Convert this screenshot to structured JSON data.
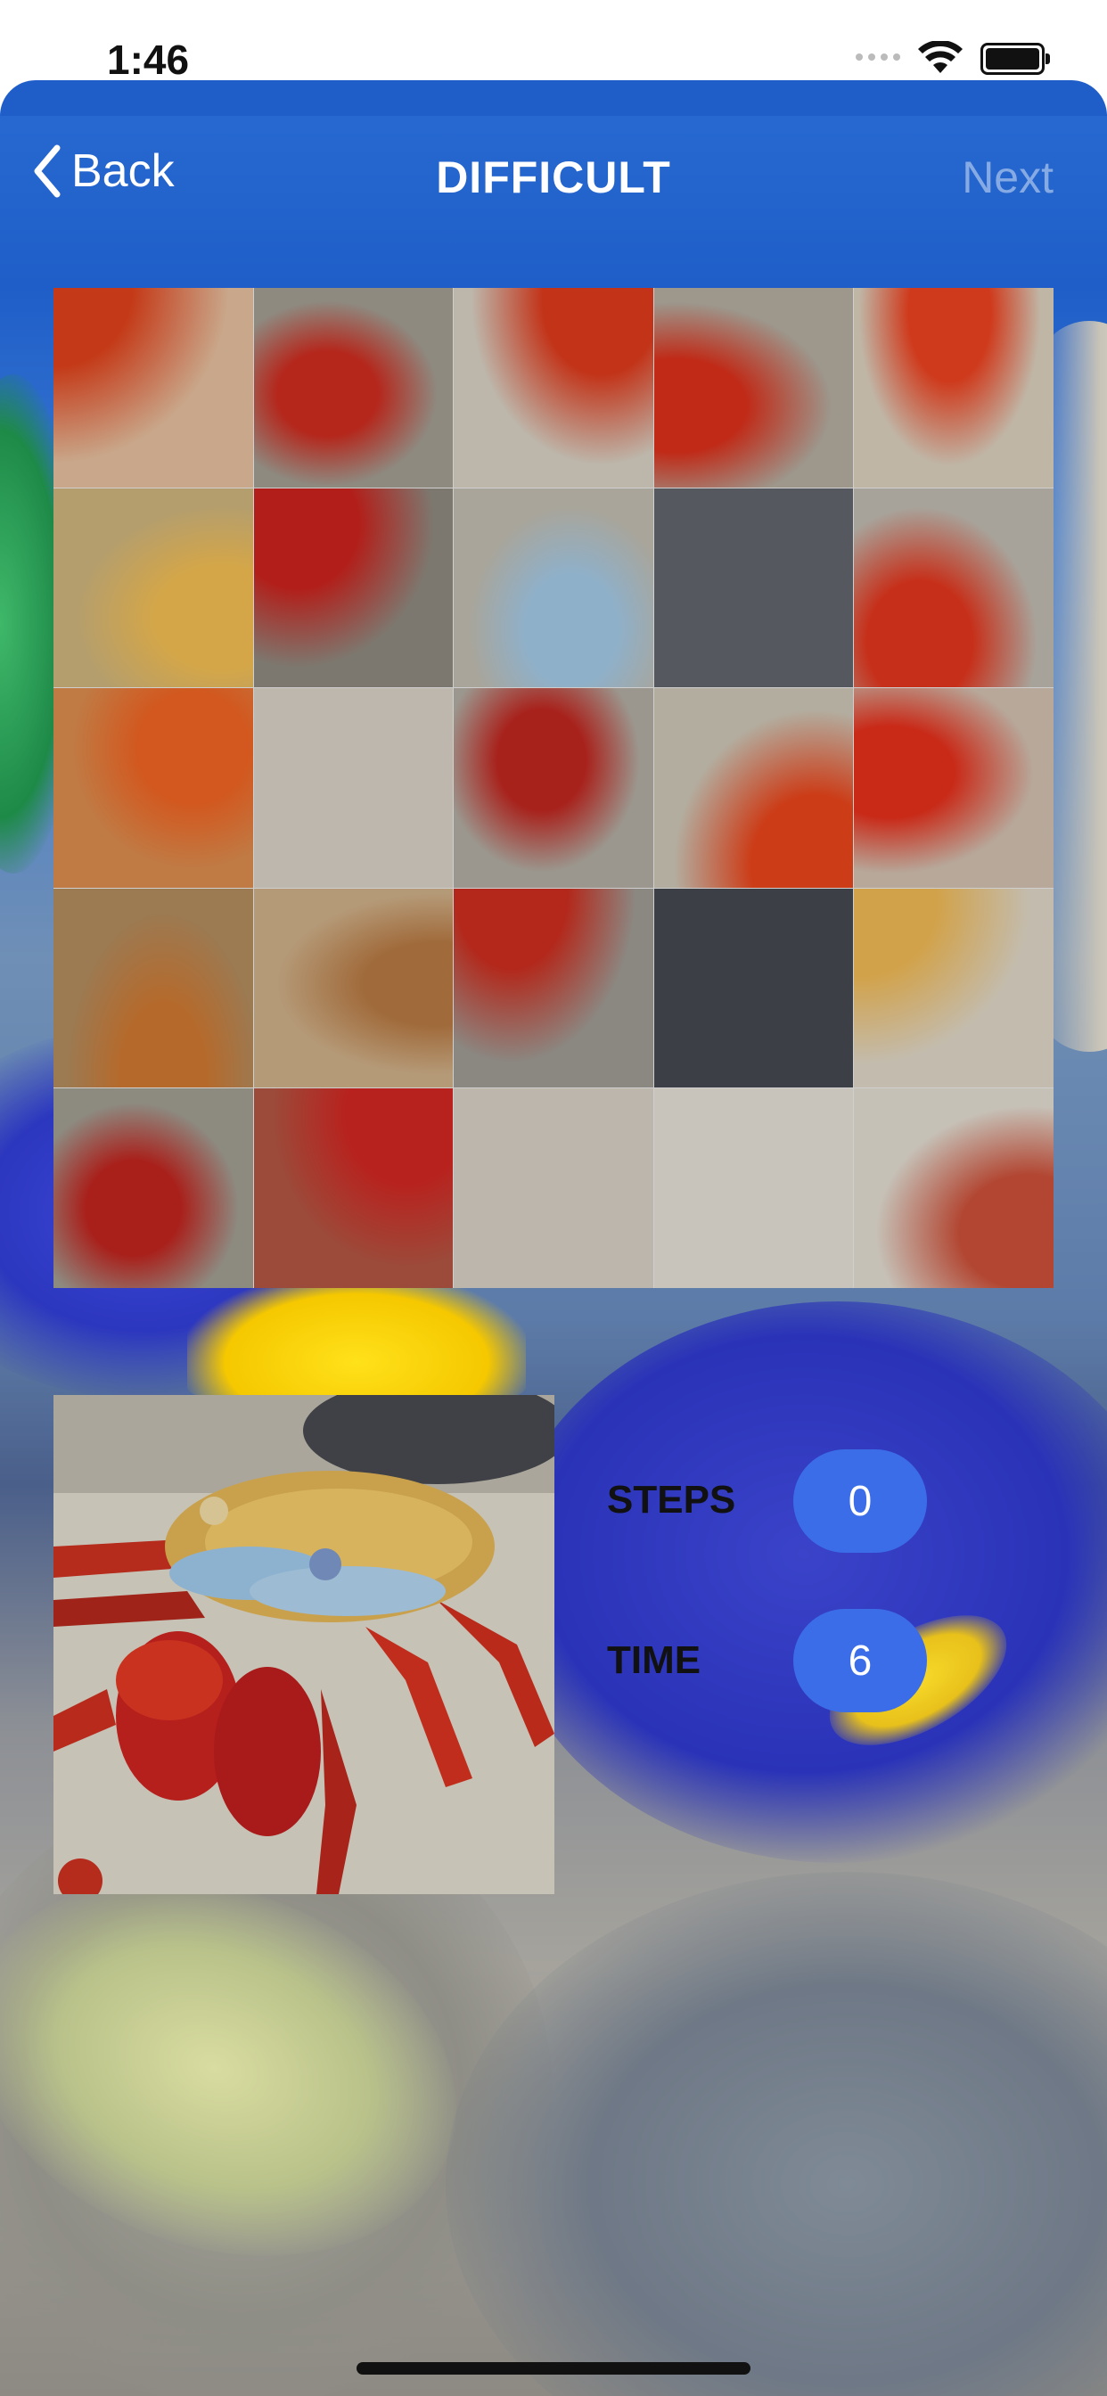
{
  "status_bar": {
    "time": "1:46"
  },
  "nav": {
    "back_label": "Back",
    "title": "DIFFICULT",
    "next_label": "Next"
  },
  "stats": {
    "steps_label": "STEPS",
    "steps_value": "0",
    "time_label": "TIME",
    "time_value": "6"
  },
  "board": {
    "size": 5,
    "tiles": [
      {
        "bg": "#c9a78a",
        "fg": "#c43a18"
      },
      {
        "bg": "#8e8a80",
        "fg": "#b5261b"
      },
      {
        "bg": "#bdb6aa",
        "fg": "#c23318"
      },
      {
        "bg": "#9d978c",
        "fg": "#c02a17"
      },
      {
        "bg": "#c0b6a6",
        "fg": "#cf3a1c"
      },
      {
        "bg": "#b49e6e",
        "fg": "#d4a648"
      },
      {
        "bg": "#7d786f",
        "fg": "#b21f1a"
      },
      {
        "bg": "#a9a59a",
        "fg": "#8fb0c9"
      },
      {
        "bg": "#55585e",
        "fg": "#55585e"
      },
      {
        "bg": "#a8a39a",
        "fg": "#c6301a"
      },
      {
        "bg": "#c07b45",
        "fg": "#d2581f"
      },
      {
        "bg": "#bdb7ae",
        "fg": "#bdb7ae"
      },
      {
        "bg": "#9b978e",
        "fg": "#a8221c"
      },
      {
        "bg": "#b3ad9f",
        "fg": "#cc3c17"
      },
      {
        "bg": "#b7a89a",
        "fg": "#c92a18"
      },
      {
        "bg": "#9c7a52",
        "fg": "#b56a2c"
      },
      {
        "bg": "#b59a78",
        "fg": "#a06a3a"
      },
      {
        "bg": "#8b8882",
        "fg": "#b3281b"
      },
      {
        "bg": "#3d3f46",
        "fg": "#3d3f46"
      },
      {
        "bg": "#c3bcae",
        "fg": "#d2a24a"
      },
      {
        "bg": "#8d8a80",
        "fg": "#a9201b"
      },
      {
        "bg": "#9c4a3a",
        "fg": "#b8221e"
      },
      {
        "bg": "#bdb6ac",
        "fg": "#bdb6ac"
      },
      {
        "bg": "#c8c4bb",
        "fg": "#c8c4bb"
      },
      {
        "bg": "#c6c1b7",
        "fg": "#b24632"
      }
    ]
  }
}
